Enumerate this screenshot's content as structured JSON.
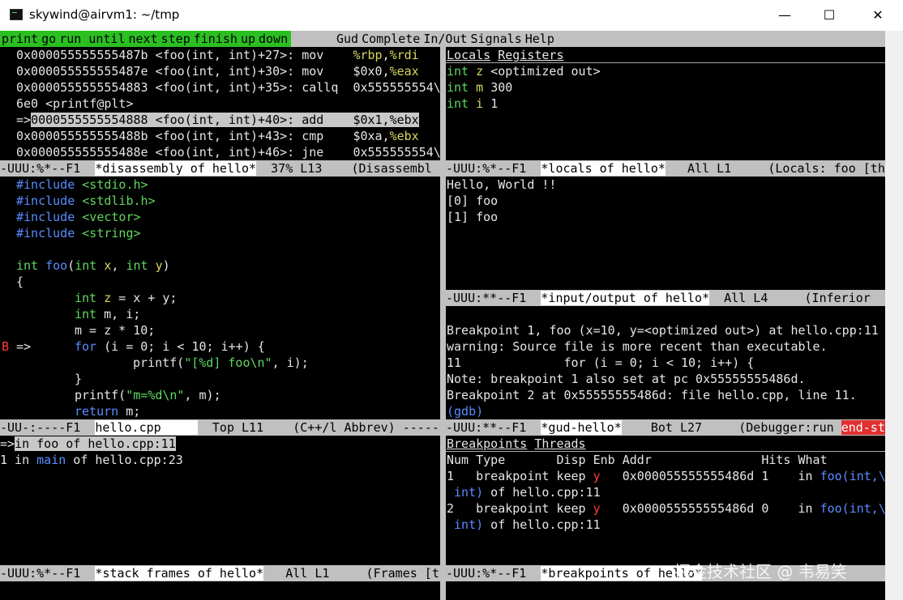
{
  "window": {
    "title": "skywind@airvm1: ~/tmp",
    "min": "—",
    "max": "☐",
    "close": "✕"
  },
  "menubar": {
    "left": [
      "print",
      "go",
      "run until",
      "next",
      "step",
      "finish",
      "up",
      "down"
    ],
    "right": [
      "Gud",
      "Complete",
      "In/Out",
      "Signals",
      "Help"
    ]
  },
  "disasm": {
    "lines": [
      {
        "addr": "0x000055555555487b",
        "fn": "<foo(int, int)+27>:",
        "op": "mov",
        "args1": "%rbp",
        "sep": ",",
        "args2": "%rdi"
      },
      {
        "addr": "0x000055555555487e",
        "fn": "<foo(int, int)+30>:",
        "op": "mov",
        "args1": "$0x0",
        "sep": ",",
        "args2": "%eax"
      },
      {
        "addr": "0x0000555555554883",
        "fn": "<foo(int, int)+35>:",
        "op": "callq",
        "args1": "0x555555554",
        "sep": "\\",
        "args2": ""
      },
      {
        "text": "6e0 <printf@plt>"
      },
      {
        "arrow": "=>",
        "addr": "0000555555554888",
        "fn": "<foo(int, int)+40>:",
        "op": "add",
        "args": "$0x1,%ebx"
      },
      {
        "addr": "0x000055555555488b",
        "fn": "<foo(int, int)+43>:",
        "op": "cmp",
        "args1": "$0xa",
        "sep": ",",
        "args2": "%ebx"
      },
      {
        "addr": "0x000055555555488e",
        "fn": "<foo(int, int)+46>:",
        "op": "jne",
        "args1": "0x555555554",
        "sep": "\\",
        "args2": ""
      }
    ],
    "modeline": {
      "pre": "-UUU:%*--F1  ",
      "buf": "*disassembly of hello*",
      "post": "  37% L13    (Disassembl"
    }
  },
  "locals": {
    "tabs": [
      "Locals",
      "Registers"
    ],
    "vars": [
      {
        "type": "int",
        "name": "z",
        "value": "<optimized out>"
      },
      {
        "type": "int",
        "name": "m",
        "value": "300"
      },
      {
        "type": "int",
        "name": "i",
        "value": "1"
      }
    ],
    "modeline": {
      "pre": "-UUU:%*--F1  ",
      "buf": "*locals of hello*",
      "post": "   All L1     (Locals: foo [th"
    }
  },
  "source": {
    "includes": [
      {
        "kw": "#include",
        "file": "<stdio.h>"
      },
      {
        "kw": "#include",
        "file": "<stdlib.h>"
      },
      {
        "kw": "#include",
        "file": "<vector>"
      },
      {
        "kw": "#include",
        "file": "<string>"
      }
    ],
    "sig": {
      "type": "int",
      "name": "foo",
      "p1type": "int",
      "p1": "x",
      "p2type": "int",
      "p2": "y"
    },
    "brace_open": "{",
    "decl1": {
      "type": "int",
      "var": "z",
      "rest": " = x + y;"
    },
    "decl2": {
      "type": "int",
      "rest": " m, i;"
    },
    "assign": "m = z * 10;",
    "bp_marker": "B",
    "bp_arrow": "=>",
    "for_kw": "for",
    "for_rest": " (i = 0; i < 10; i++) {",
    "printf1_pre": "printf(",
    "printf1_str": "\"[%d] foo\\n\"",
    "printf1_post": ", i);",
    "close_inner": "}",
    "printf2_pre": "printf(",
    "printf2_str": "\"m=%d\\n\"",
    "printf2_post": ", m);",
    "ret_kw": "return",
    "ret_rest": " m;",
    "modeline": {
      "pre": "-UU-:----F1  ",
      "buf": "hello.cpp     ",
      "post": "  Top L11    (C++/l Abbrev) ------"
    }
  },
  "io": {
    "lines": [
      "Hello, World !!",
      "[0] foo",
      "[1] foo"
    ],
    "modeline": {
      "pre": "-UUU:**--F1  ",
      "buf": "*input/output of hello*",
      "post": "  All L4     (Inferior"
    }
  },
  "gud": {
    "lines": [
      "Breakpoint 1, foo (x=10, y=<optimized out>) at hello.cpp:11",
      "warning: Source file is more recent than executable.",
      "11              for (i = 0; i < 10; i++) {",
      "Note: breakpoint 1 also set at pc 0x55555555486d.",
      "Breakpoint 2 at 0x55555555486d: file hello.cpp, line 11."
    ],
    "prompt": "(gdb)",
    "modeline": {
      "pre": "-UUU:**--F1  ",
      "buf": "*gud-hello*",
      "post": "    Bot L27     (Debugger:run ",
      "tail": "end-st"
    }
  },
  "stack": {
    "current": {
      "arrow": "=>",
      "text": "in foo of hello.cpp:11"
    },
    "frame1": {
      "num": "1",
      "in": " in ",
      "fn": "main",
      "rest": " of hello.cpp:23"
    },
    "modeline": {
      "pre": "-UUU:%*--F1  ",
      "buf": "*stack frames of hello*",
      "post": "   All L1     (Frames [t"
    }
  },
  "breakpoints": {
    "tabs": [
      "Breakpoints",
      "Threads"
    ],
    "header": "Num Type       Disp Enb Addr               Hits What",
    "rows": [
      {
        "num": "1",
        "type": "breakpoint",
        "disp": "keep",
        "enb": "y",
        "addr": "0x000055555555486d",
        "hits": "1",
        "what_pre": "in ",
        "what_fn": "foo(int,\\",
        "cont_type": " int)",
        "cont_rest": " of hello.cpp:11"
      },
      {
        "num": "2",
        "type": "breakpoint",
        "disp": "keep",
        "enb": "y",
        "addr": "0x000055555555486d",
        "hits": "0",
        "what_pre": "in ",
        "what_fn": "foo(int,\\",
        "cont_type": " int)",
        "cont_rest": " of hello.cpp:11"
      }
    ],
    "modeline": {
      "pre": "-UUU:%*--F1  ",
      "buf": "*breakpoints of hello*",
      "post": ""
    }
  },
  "watermark": "掘金技术社区 @ 韦易笑",
  "colors": {
    "menu_green": "#2bbf22",
    "modeline": "#c0c0c0",
    "keyword": "#5a8cff",
    "type": "#5fd75f",
    "variable": "#d7d75f",
    "breakpoint": "#ff3b3b"
  }
}
